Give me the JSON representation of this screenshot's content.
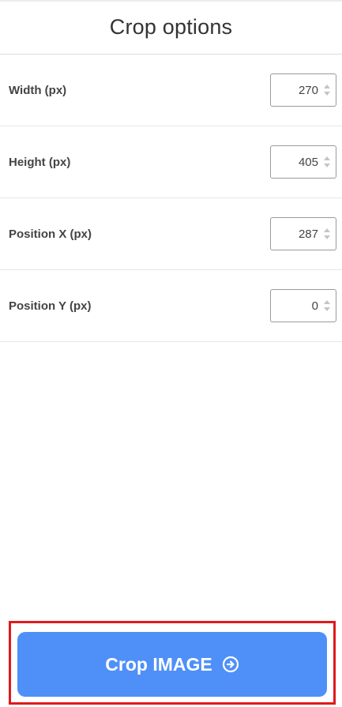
{
  "header": {
    "title": "Crop options"
  },
  "fields": [
    {
      "label": "Width (px)",
      "value": "270"
    },
    {
      "label": "Height (px)",
      "value": "405"
    },
    {
      "label": "Position X (px)",
      "value": "287"
    },
    {
      "label": "Position Y (px)",
      "value": "0"
    }
  ],
  "footer": {
    "button_label": "Crop IMAGE",
    "button_icon": "arrow-right-circle-icon",
    "button_color": "#4f90f8",
    "highlight_color": "#e01a1a"
  }
}
